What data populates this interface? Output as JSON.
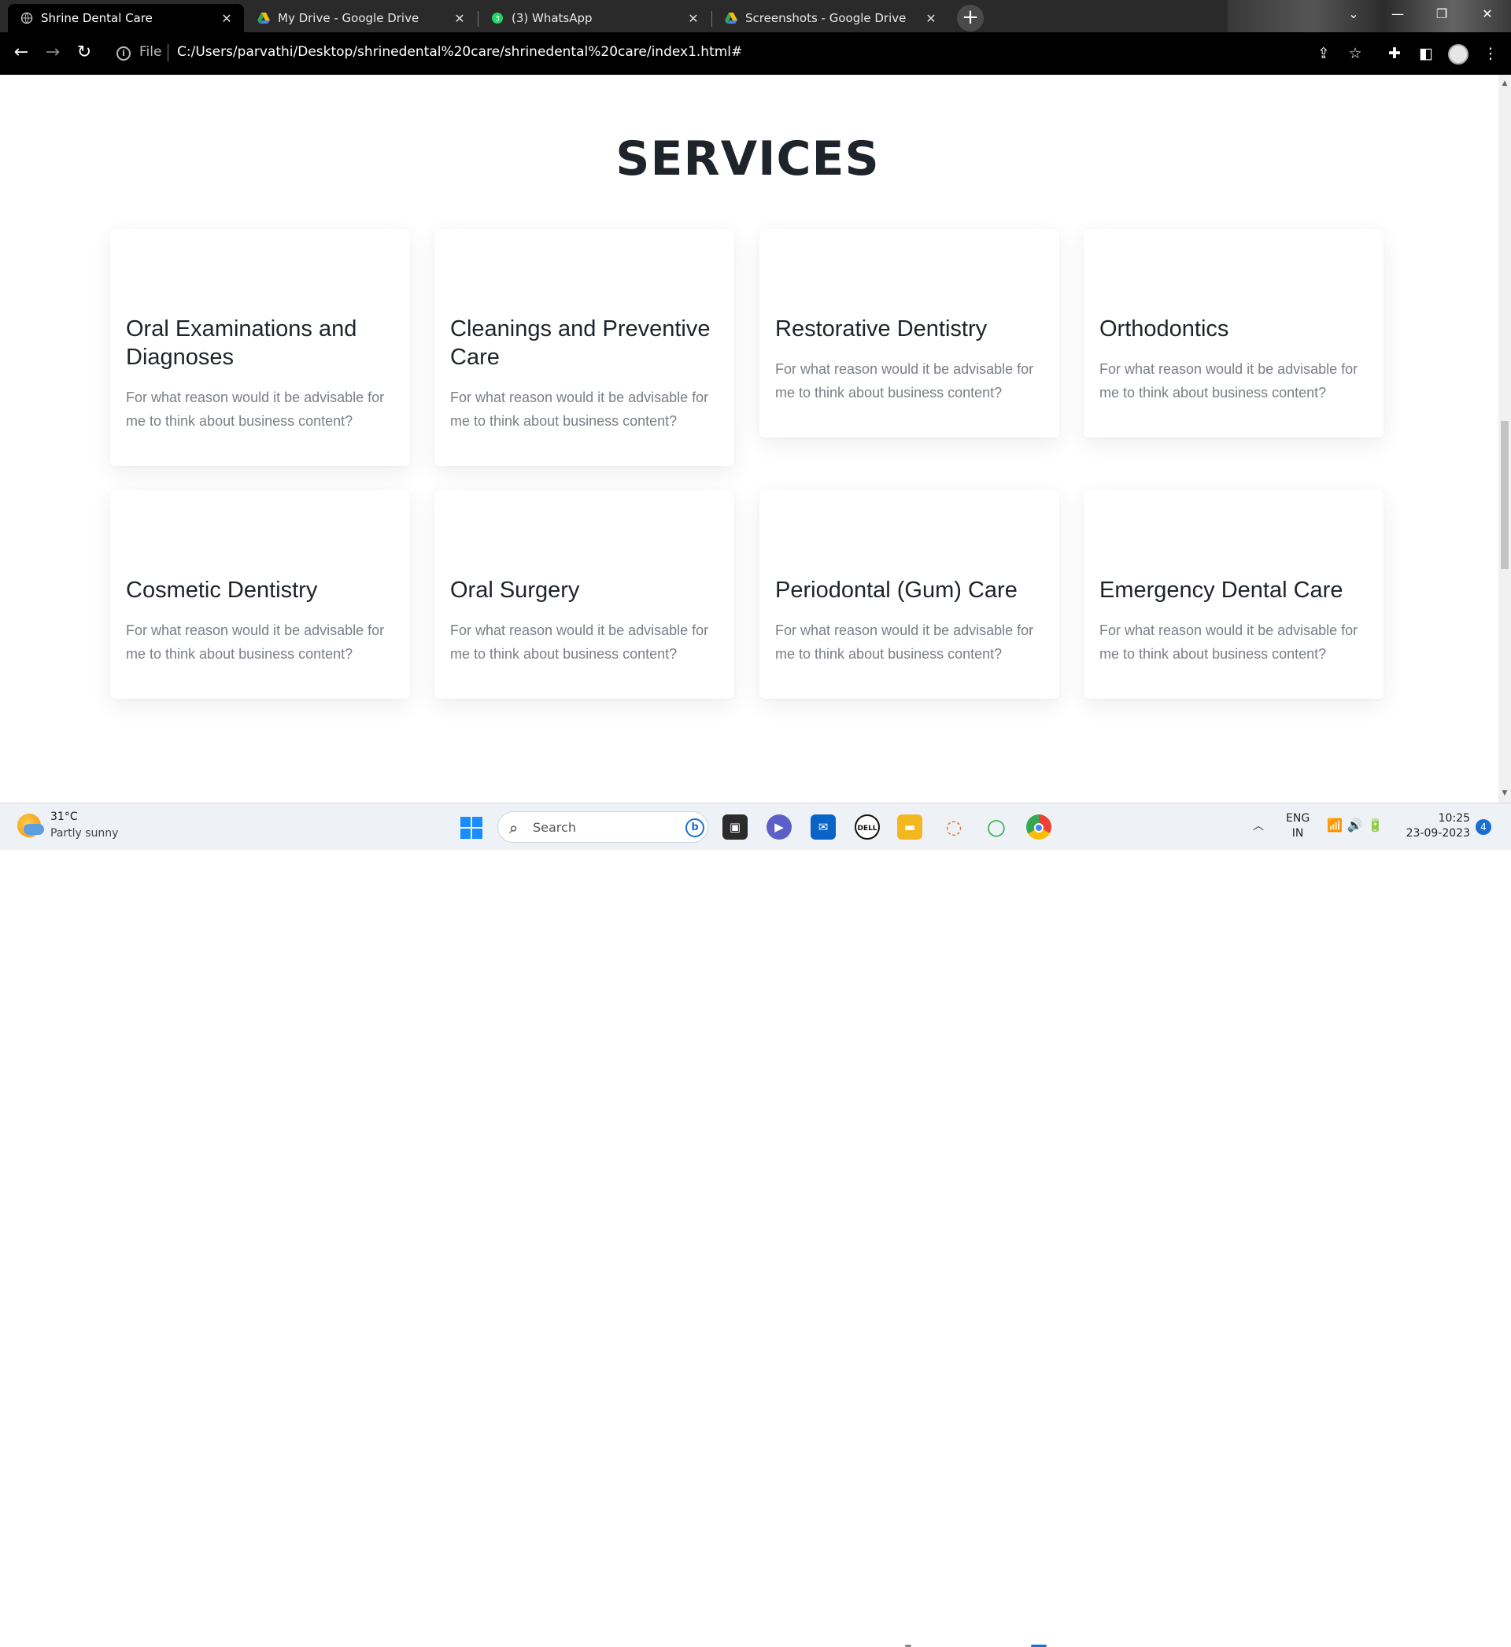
{
  "browser": {
    "tabs": [
      {
        "label": "Shrine Dental Care",
        "active": true
      },
      {
        "label": "My Drive - Google Drive",
        "active": false
      },
      {
        "label": "(3) WhatsApp",
        "active": false
      },
      {
        "label": "Screenshots - Google Drive",
        "active": false
      }
    ],
    "file_label": "File",
    "url": "C:/Users/parvathi/Desktop/shrinedental%20care/shrinedental%20care/index1.html#"
  },
  "services": {
    "title": "SERVICES",
    "cards": [
      {
        "title": "Oral Examinations and Diagnoses",
        "text": "For what reason would it be advisable for me to think about business content?"
      },
      {
        "title": "Cleanings and Preventive Care",
        "text": "For what reason would it be advisable for me to think about business content?"
      },
      {
        "title": "Restorative Dentistry",
        "text": "For what reason would it be advisable for me to think about business content?"
      },
      {
        "title": "Orthodontics",
        "text": "For what reason would it be advisable for me to think about business content?"
      },
      {
        "title": "Cosmetic Dentistry",
        "text": "For what reason would it be advisable for me to think about business content?"
      },
      {
        "title": "Oral Surgery",
        "text": "For what reason would it be advisable for me to think about business content?"
      },
      {
        "title": "Periodontal (Gum) Care",
        "text": "For what reason would it be advisable for me to think about business content?"
      },
      {
        "title": "Emergency Dental Care",
        "text": "For what reason would it be advisable for me to think about business content?"
      }
    ]
  },
  "taskbar": {
    "weather": {
      "temp": "31°C",
      "condition": "Partly sunny"
    },
    "search_label": "Search",
    "language": {
      "line1": "ENG",
      "line2": "IN"
    },
    "time": "10:25",
    "date": "23-09-2023",
    "notification_count": "4"
  },
  "colors": {
    "accent": "#1a6fd1",
    "heading": "#1f232a",
    "body_text": "#7a7f86"
  }
}
